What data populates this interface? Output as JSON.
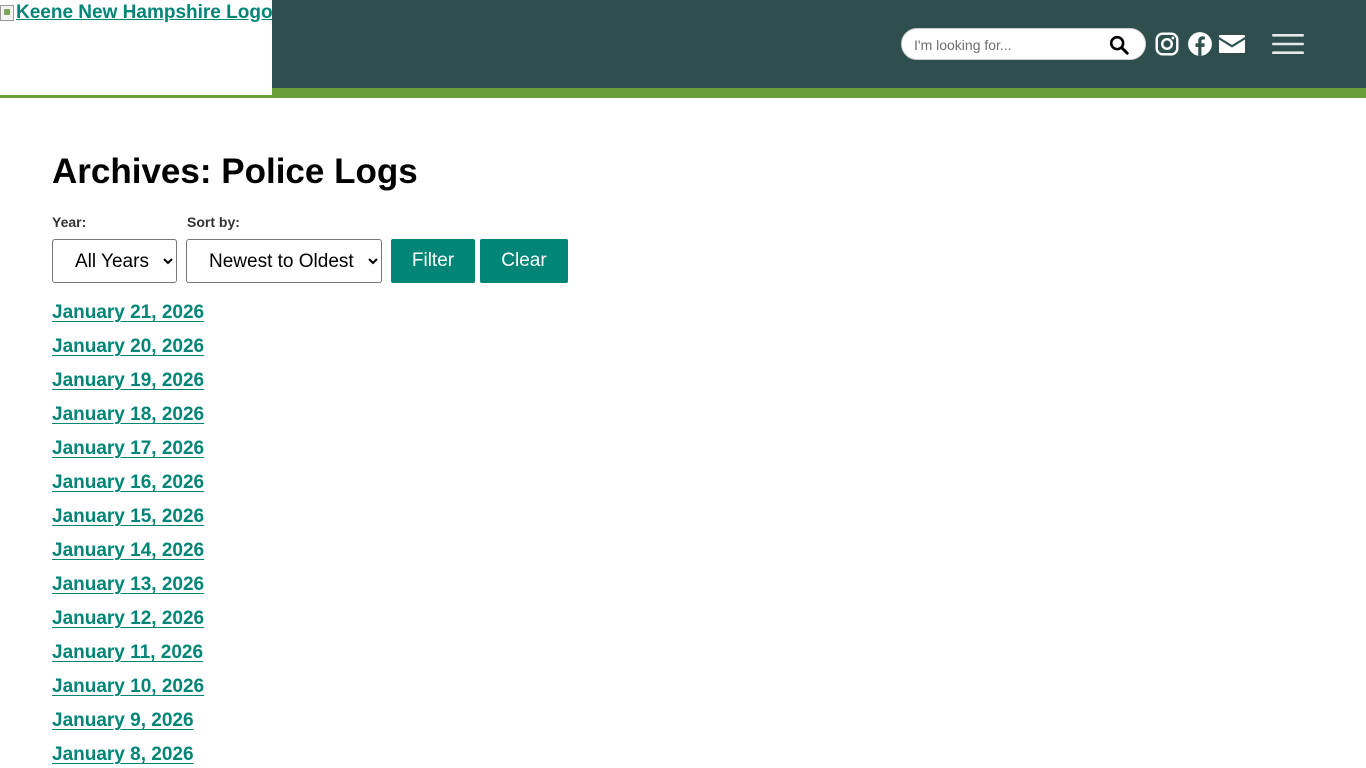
{
  "header": {
    "logo_alt": "Keene New Hampshire Logo",
    "search_placeholder": "I'm looking for...",
    "icons": [
      "search-icon",
      "instagram-icon",
      "facebook-icon",
      "email-icon",
      "hamburger-menu-icon"
    ],
    "colors": {
      "header_bg": "#2f4f4f",
      "stripe": "#6a9e3a",
      "accent": "#008577"
    }
  },
  "main": {
    "title": "Archives: Police Logs",
    "filters": {
      "year_label": "Year:",
      "year_value": "All Years",
      "sort_label": "Sort by:",
      "sort_value": "Newest to Oldest",
      "filter_button": "Filter",
      "clear_button": "Clear"
    },
    "logs": [
      "January 21, 2026",
      "January 20, 2026",
      "January 19, 2026",
      "January 18, 2026",
      "January 17, 2026",
      "January 16, 2026",
      "January 15, 2026",
      "January 14, 2026",
      "January 13, 2026",
      "January 12, 2026",
      "January 11, 2026",
      "January 10, 2026",
      "January 9, 2026",
      "January 8, 2026"
    ]
  }
}
